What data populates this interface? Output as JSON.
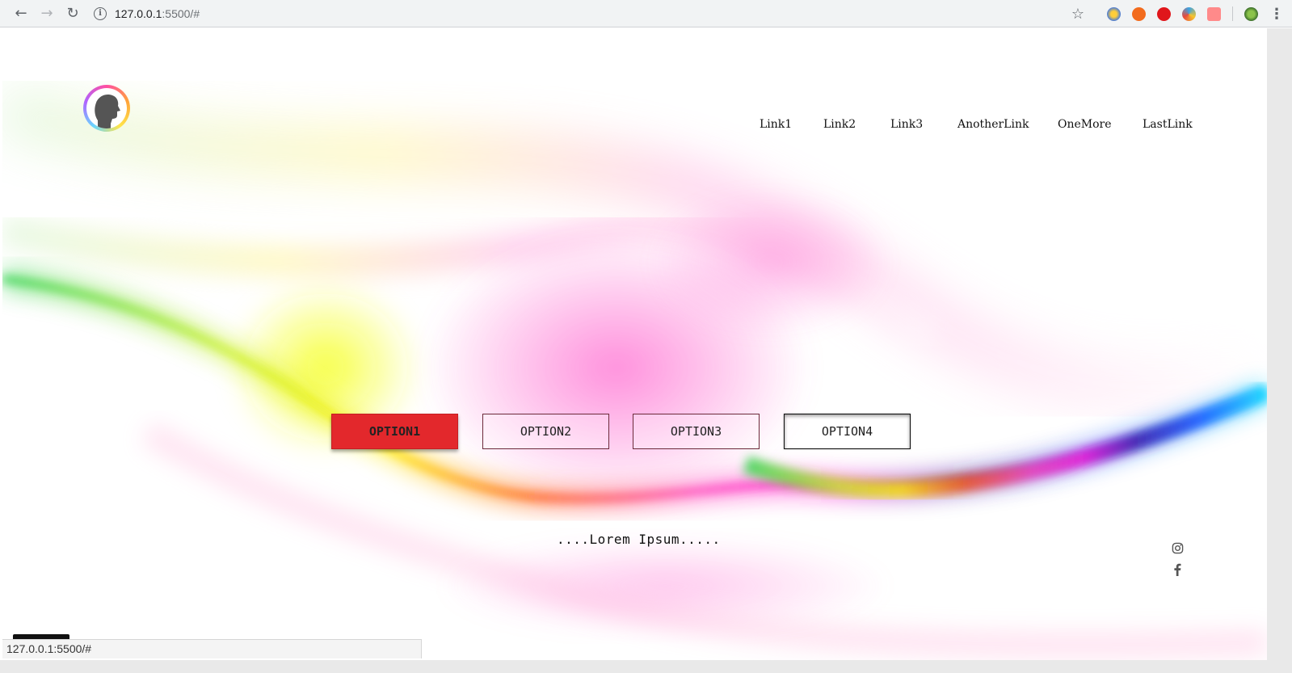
{
  "browser": {
    "url_host": "127.0.0.1",
    "url_rest": ":5500/#",
    "status_url": "127.0.0.1:5500/#"
  },
  "nav": {
    "links": [
      "Link1",
      "Link2",
      "Link3",
      "AnotherLink",
      "OneMore",
      "LastLink"
    ]
  },
  "options": [
    "OPTION1",
    "OPTION2",
    "OPTION3",
    "OPTION4"
  ],
  "tagline": "....Lorem Ipsum.....",
  "social": [
    "instagram-icon",
    "facebook-icon"
  ],
  "colors": {
    "active_option": "#e3282c"
  }
}
